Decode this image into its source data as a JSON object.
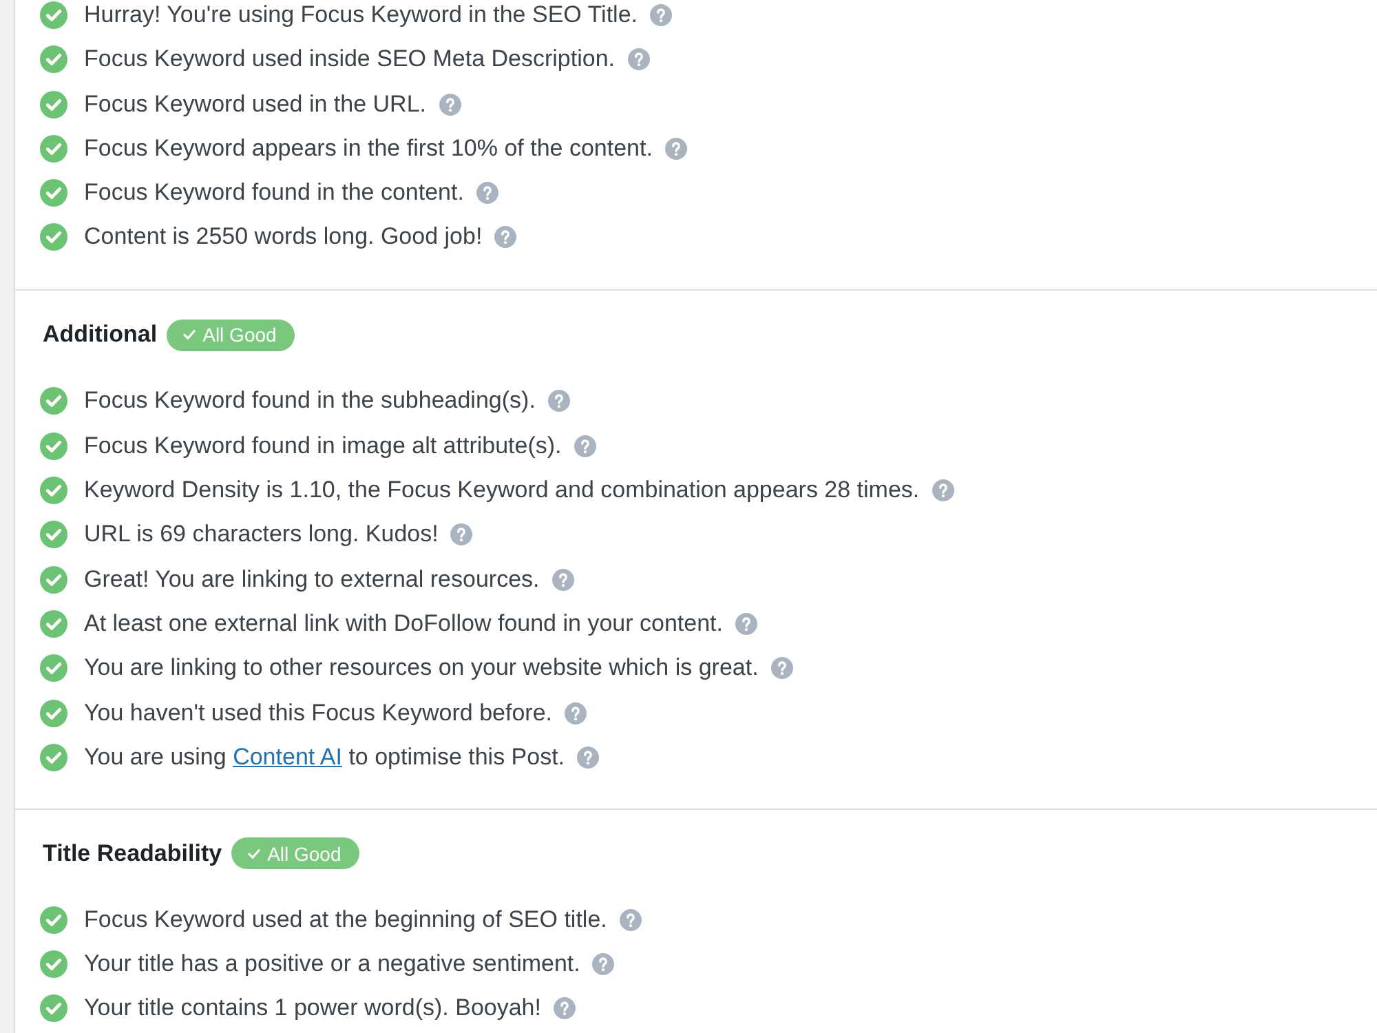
{
  "sections": [
    {
      "items": [
        {
          "text": "Hurray! You're using Focus Keyword in the SEO Title.",
          "passed": true
        },
        {
          "text": "Focus Keyword used inside SEO Meta Description.",
          "passed": true
        },
        {
          "text": "Focus Keyword used in the URL.",
          "passed": true
        },
        {
          "text": "Focus Keyword appears in the first 10% of the content.",
          "passed": true
        },
        {
          "text": "Focus Keyword found in the content.",
          "passed": true
        },
        {
          "text": "Content is 2550 words long. Good job!",
          "passed": true
        }
      ]
    },
    {
      "title": "Additional",
      "badge": "All Good",
      "items": [
        {
          "text": "Focus Keyword found in the subheading(s).",
          "passed": true
        },
        {
          "text": "Focus Keyword found in image alt attribute(s).",
          "passed": true
        },
        {
          "text": "Keyword Density is 1.10, the Focus Keyword and combination appears 28 times.",
          "passed": true
        },
        {
          "text": "URL is 69 characters long. Kudos!",
          "passed": true
        },
        {
          "text": "Great! You are linking to external resources.",
          "passed": true
        },
        {
          "text": "At least one external link with DoFollow found in your content.",
          "passed": true
        },
        {
          "text": "You are linking to other resources on your website which is great.",
          "passed": true
        },
        {
          "text": "You haven't used this Focus Keyword before.",
          "passed": true
        },
        {
          "text": "You are using ",
          "link": "Content AI",
          "text_after": " to optimise this Post.",
          "passed": true
        }
      ]
    },
    {
      "title": "Title Readability",
      "badge": "All Good",
      "items": [
        {
          "text": "Focus Keyword used at the beginning of SEO title.",
          "passed": true
        },
        {
          "text": "Your title has a positive or a negative sentiment.",
          "passed": true
        },
        {
          "text": "Your title contains 1 power word(s). Booyah!",
          "passed": true
        }
      ]
    }
  ]
}
